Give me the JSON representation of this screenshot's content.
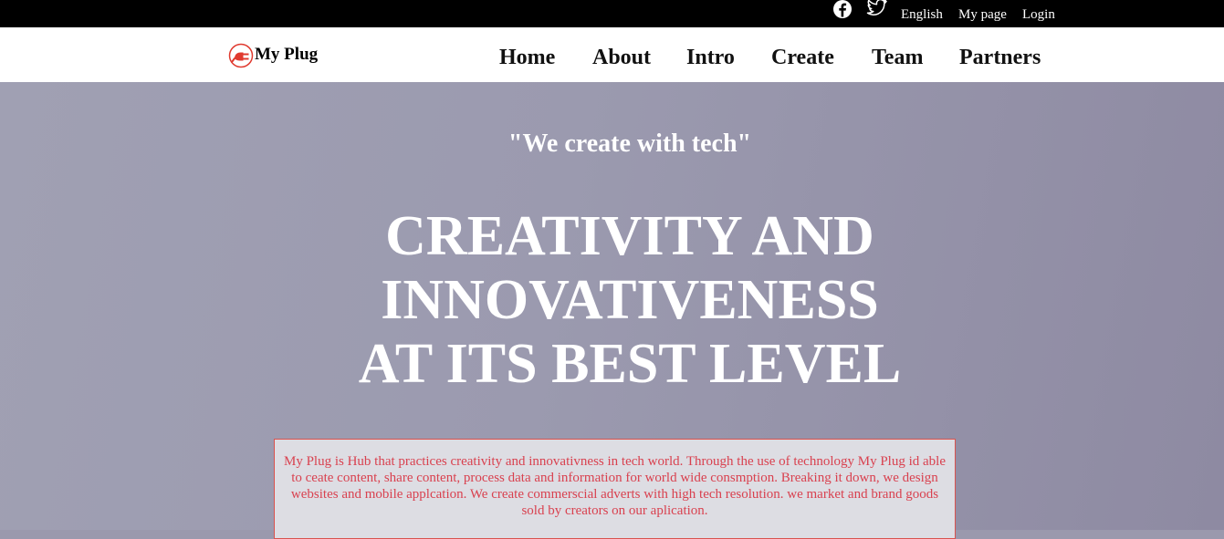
{
  "topbar": {
    "icons": [
      "facebook-icon",
      "twitter-icon"
    ],
    "links": {
      "language": "English",
      "my_page": "My page",
      "login": "Login"
    }
  },
  "navbar": {
    "brand": "My Plug",
    "items": [
      "Home",
      "About",
      "Intro",
      "Create",
      "Team",
      "Partners"
    ]
  },
  "hero": {
    "tagline": "\"We create with tech\"",
    "headline_lines": [
      "CREATIVITY AND",
      "INNOVATIVENESS",
      "AT ITS BEST LEVEL"
    ],
    "description": "My Plug is Hub that practices creativity and innovativness in tech world. Through the use of technology My Plug id able to ceate content, share content, process data and information for world wide consmption. Breaking it down, we design websites and mobile applcation. We create commerscial adverts with high tech resolution. we market and brand goods sold by creators on our aplication."
  },
  "colors": {
    "topbar_bg": "#000000",
    "navbar_bg": "#ffffff",
    "hero_bg": "#9a99ad",
    "accent_red": "#d9414f",
    "logo_red": "#e03a2f"
  }
}
